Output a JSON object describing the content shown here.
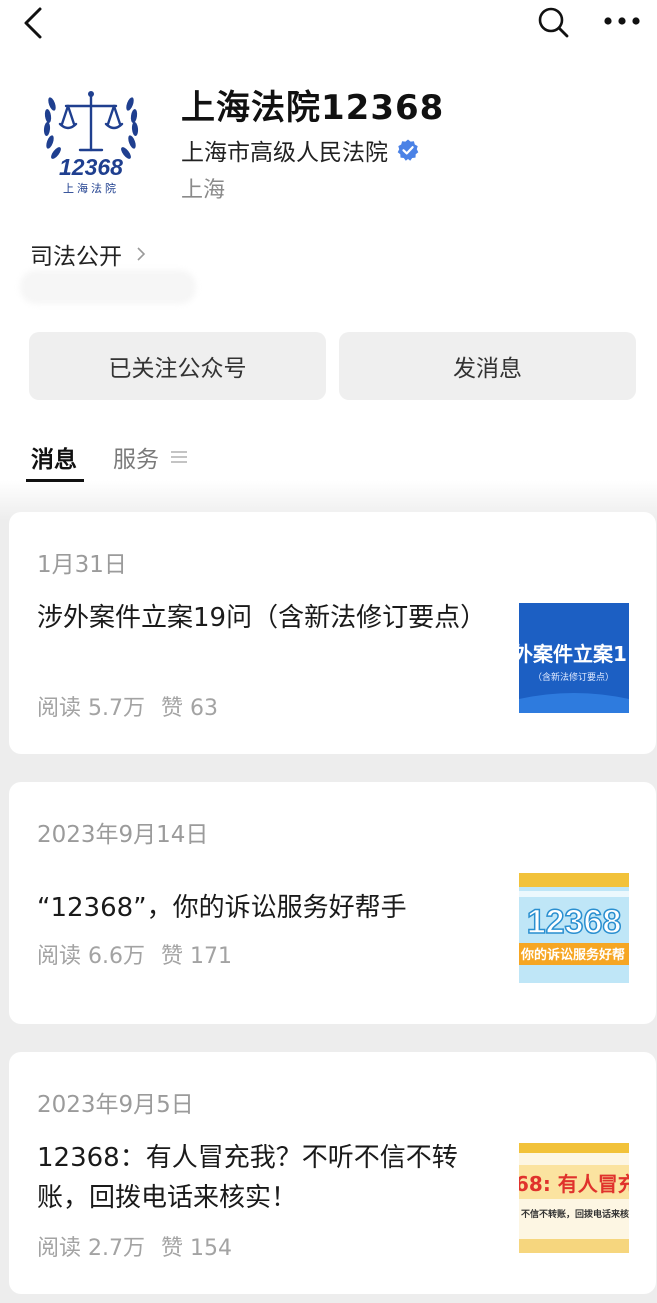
{
  "account": {
    "name": "上海法院12368",
    "org": "上海市高级人民法院",
    "location": "上海",
    "logo_number": "12368",
    "logo_caption": "上海法院"
  },
  "tag": {
    "label": "司法公开"
  },
  "buttons": {
    "follow": "已关注公众号",
    "message": "发消息"
  },
  "tabs": {
    "messages": "消息",
    "services": "服务"
  },
  "colors": {
    "verified": "#4b82e6",
    "logo_navy": "#1f3f8f"
  },
  "articles": [
    {
      "date": "1月31日",
      "title": "涉外案件立案19问（含新法修订要点）",
      "reads": "阅读 5.7万",
      "likes": "赞 63",
      "thumb_text": "外案件立案1",
      "thumb_sub": "（含新法修订要点）"
    },
    {
      "date": "2023年9月14日",
      "title": "“12368”，你的诉讼服务好帮手",
      "reads": "阅读 6.6万",
      "likes": "赞 171",
      "thumb_text": "12368",
      "thumb_sub": "你的诉讼服务好帮"
    },
    {
      "date": "2023年9月5日",
      "title": "12368：有人冒充我？不听不信不转账，回拨电话来核实！",
      "reads": "阅读 2.7万",
      "likes": "赞 154",
      "thumb_text": "68: 有人冒充",
      "thumb_sub": "不信不转账，回拨电话来核"
    }
  ]
}
